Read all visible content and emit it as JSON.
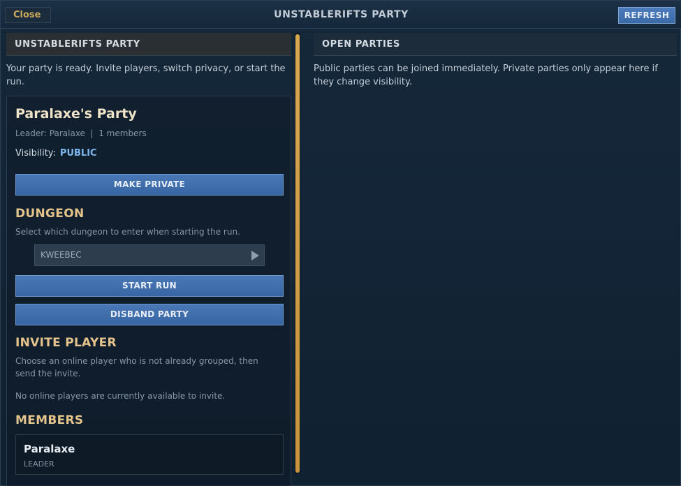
{
  "window": {
    "title": "UNSTABLERIFTS PARTY",
    "close_label": "Close",
    "refresh_label": "REFRESH"
  },
  "left_panel": {
    "header": "UNSTABLERIFTS PARTY",
    "intro": "Your party is ready. Invite players, switch privacy, or start the run.",
    "party": {
      "name": "Paralaxe's Party",
      "meta": "Leader: Paralaxe  |  1 members",
      "visibility_label": "Visibility:",
      "visibility_value": "PUBLIC",
      "privacy_button": "MAKE PRIVATE"
    },
    "dungeon": {
      "title": "DUNGEON",
      "description": "Select which dungeon to enter when starting the run.",
      "selected": "KWEEBEC",
      "start_button": "START RUN",
      "disband_button": "DISBAND PARTY"
    },
    "invite": {
      "title": "INVITE PLAYER",
      "description": "Choose an online player who is not already grouped, then send the invite.",
      "empty_message": "No online players are currently available to invite."
    },
    "members": {
      "title": "MEMBERS",
      "list": [
        {
          "name": "Paralaxe",
          "role": "LEADER"
        }
      ]
    }
  },
  "right_panel": {
    "header": "OPEN PARTIES",
    "description": "Public parties can be joined immediately. Private parties only appear here if they change visibility."
  },
  "colors": {
    "accent_gold": "#e5c48c",
    "button_blue": "#4a78b6",
    "public_blue": "#7fb8ee",
    "scroll_gold": "#d8a84f"
  }
}
